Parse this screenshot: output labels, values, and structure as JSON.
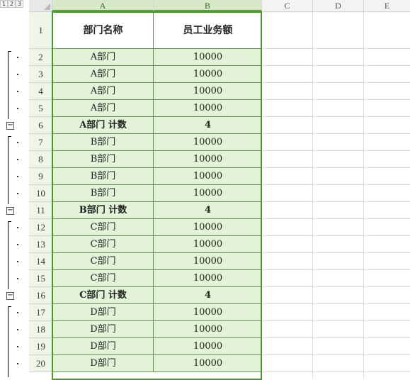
{
  "outline_levels": [
    "1",
    "2",
    "3"
  ],
  "columns": [
    "A",
    "B",
    "C",
    "D",
    "E"
  ],
  "header": {
    "dept": "部门名称",
    "amount": "员工业务额"
  },
  "rows": [
    {
      "n": "2",
      "dept": "A部门",
      "amount": "10000"
    },
    {
      "n": "3",
      "dept": "A部门",
      "amount": "10000"
    },
    {
      "n": "4",
      "dept": "A部门",
      "amount": "10000"
    },
    {
      "n": "5",
      "dept": "A部门",
      "amount": "10000"
    },
    {
      "n": "6",
      "dept": "A部门 计数",
      "amount": "4",
      "subtotal": true
    },
    {
      "n": "7",
      "dept": "B部门",
      "amount": "10000"
    },
    {
      "n": "8",
      "dept": "B部门",
      "amount": "10000"
    },
    {
      "n": "9",
      "dept": "B部门",
      "amount": "10000"
    },
    {
      "n": "10",
      "dept": "B部门",
      "amount": "10000"
    },
    {
      "n": "11",
      "dept": "B部门 计数",
      "amount": "4",
      "subtotal": true
    },
    {
      "n": "12",
      "dept": "C部门",
      "amount": "10000"
    },
    {
      "n": "13",
      "dept": "C部门",
      "amount": "10000"
    },
    {
      "n": "14",
      "dept": "C部门",
      "amount": "10000"
    },
    {
      "n": "15",
      "dept": "C部门",
      "amount": "10000"
    },
    {
      "n": "16",
      "dept": "C部门 计数",
      "amount": "4",
      "subtotal": true
    },
    {
      "n": "17",
      "dept": "D部门",
      "amount": "10000"
    },
    {
      "n": "18",
      "dept": "D部门",
      "amount": "10000"
    },
    {
      "n": "19",
      "dept": "D部门",
      "amount": "10000"
    },
    {
      "n": "20",
      "dept": "D部门",
      "amount": "10000"
    }
  ],
  "header_row_number": "1",
  "collapse_symbol": "−"
}
